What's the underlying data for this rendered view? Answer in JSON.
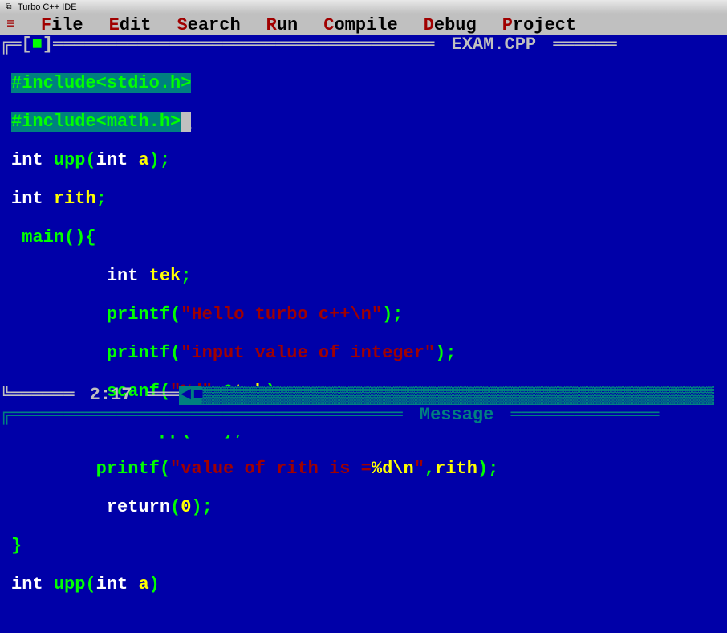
{
  "window": {
    "title": "Turbo C++ IDE"
  },
  "menu": {
    "file": "File",
    "edit": "Edit",
    "search": "Search",
    "run": "Run",
    "compile": "Compile",
    "debug": "Debug",
    "project": "Project"
  },
  "editor": {
    "filename": "EXAM.CPP",
    "cursor_pos": "2:17",
    "lines": {
      "l1_full": "#include<stdio.h>",
      "l2_full": "#include<math.h>",
      "l3_int": "int",
      "l3_upp": "upp",
      "l3_int2": "int",
      "l3_a": "a",
      "l4_int": "int",
      "l4_rith": "rith",
      "l5_main": "main",
      "l6_int": "int",
      "l6_tek": "tek",
      "l7_printf": "printf",
      "l7_str": "\"Hello turbo c++\\n\"",
      "l8_printf": "printf",
      "l8_str": "\"input value of integer\"",
      "l9_scanf": "scanf",
      "l9_fmt": "\"%d\"",
      "l9_tek": "tek",
      "l10_rith": "rith",
      "l10_upp": "upp",
      "l10_tek": "tek",
      "l11_printf": "printf",
      "l11_str1": "\"value of rith is =",
      "l11_fmt": "%d\\n",
      "l11_str2": "\"",
      "l11_rith": "rith",
      "l12_return": "return",
      "l12_zero": "0",
      "l14_int": "int",
      "l14_upp": "upp",
      "l14_int2": "int",
      "l14_a": "a"
    }
  },
  "message": {
    "title": "Message"
  }
}
